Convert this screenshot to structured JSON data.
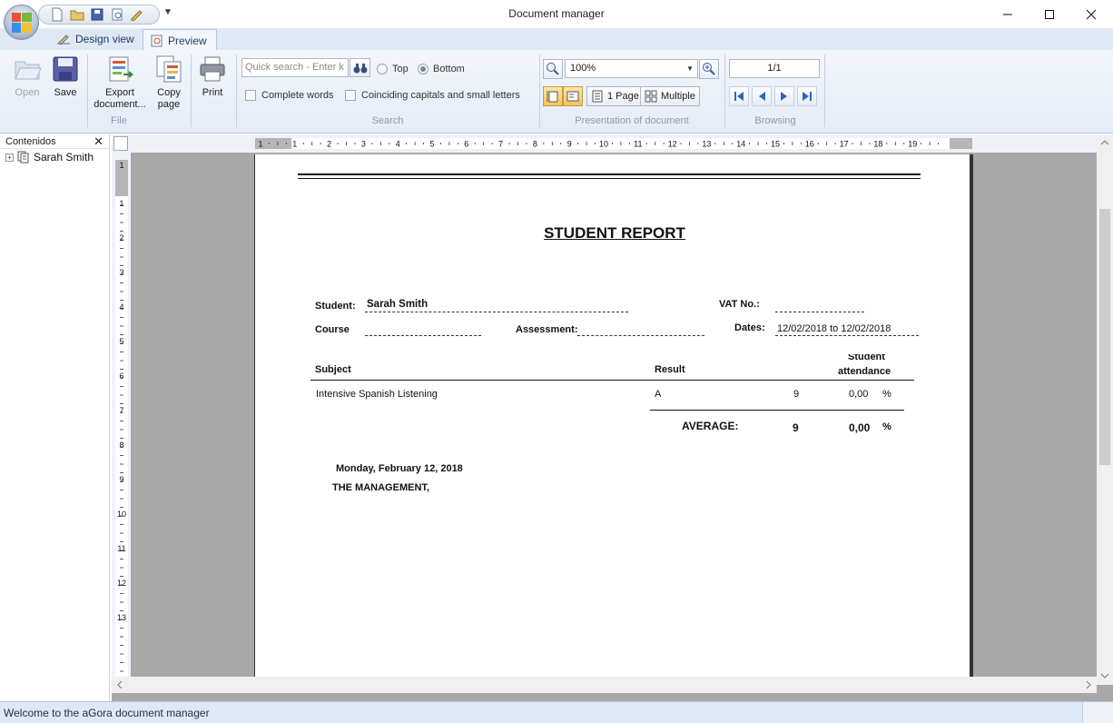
{
  "window": {
    "title": "Document manager"
  },
  "tabs": [
    {
      "label": "Design view",
      "active": false
    },
    {
      "label": "Preview",
      "active": true
    }
  ],
  "ribbon": {
    "file_group": {
      "label": "File",
      "open": "Open",
      "save": "Save",
      "export_line1": "Export",
      "export_line2": "document...",
      "copy_line1": "Copy",
      "copy_line2": "page",
      "print": "Print"
    },
    "search_group": {
      "label": "Search",
      "placeholder": "Quick search - Enter k",
      "top": "Top",
      "bottom": "Bottom",
      "complete_words": "Complete words",
      "coinciding": "Coinciding capitals and small letters"
    },
    "presentation_group": {
      "label": "Presentation of document",
      "zoom": "100%",
      "one_page": "1 Page",
      "multiple": "Multiple"
    },
    "browsing_group": {
      "label": "Browsing",
      "page_indicator": "1/1"
    }
  },
  "left_panel": {
    "title": "Contenidos",
    "items": [
      {
        "label": "Sarah Smith"
      }
    ]
  },
  "ruler": {
    "h_numbers": [
      "1",
      "1",
      "2",
      "3",
      "4",
      "5",
      "6",
      "7",
      "8",
      "9",
      "10",
      "11",
      "12",
      "13",
      "14",
      "15",
      "16",
      "17",
      "18",
      "19"
    ],
    "v_numbers": [
      "1",
      "1",
      "2",
      "3",
      "4",
      "5",
      "6",
      "7",
      "8",
      "9",
      "10",
      "11",
      "12",
      "13"
    ]
  },
  "report": {
    "title": "STUDENT REPORT",
    "student_label": "Student:",
    "student_value": "Sarah Smith",
    "vat_label": "VAT No.:",
    "course_label": "Course",
    "assessment_label": "Assessment:",
    "dates_label": "Dates:",
    "dates_value": "12/02/2018 to 12/02/2018",
    "col_subject": "Subject",
    "col_result": "Result",
    "col_attendance_top": "Student",
    "col_attendance": "attendance",
    "row": {
      "subject": "Intensive Spanish Listening",
      "result": "A",
      "num": "9",
      "percent": "0,00",
      "pct_sign": "%"
    },
    "average_label": "AVERAGE:",
    "average_num": "9",
    "average_percent": "0,00",
    "average_pct_sign": "%",
    "date_line": "Monday, February 12, 2018",
    "management": "THE MANAGEMENT,"
  },
  "status": {
    "text": "Welcome to the aGora document manager"
  }
}
